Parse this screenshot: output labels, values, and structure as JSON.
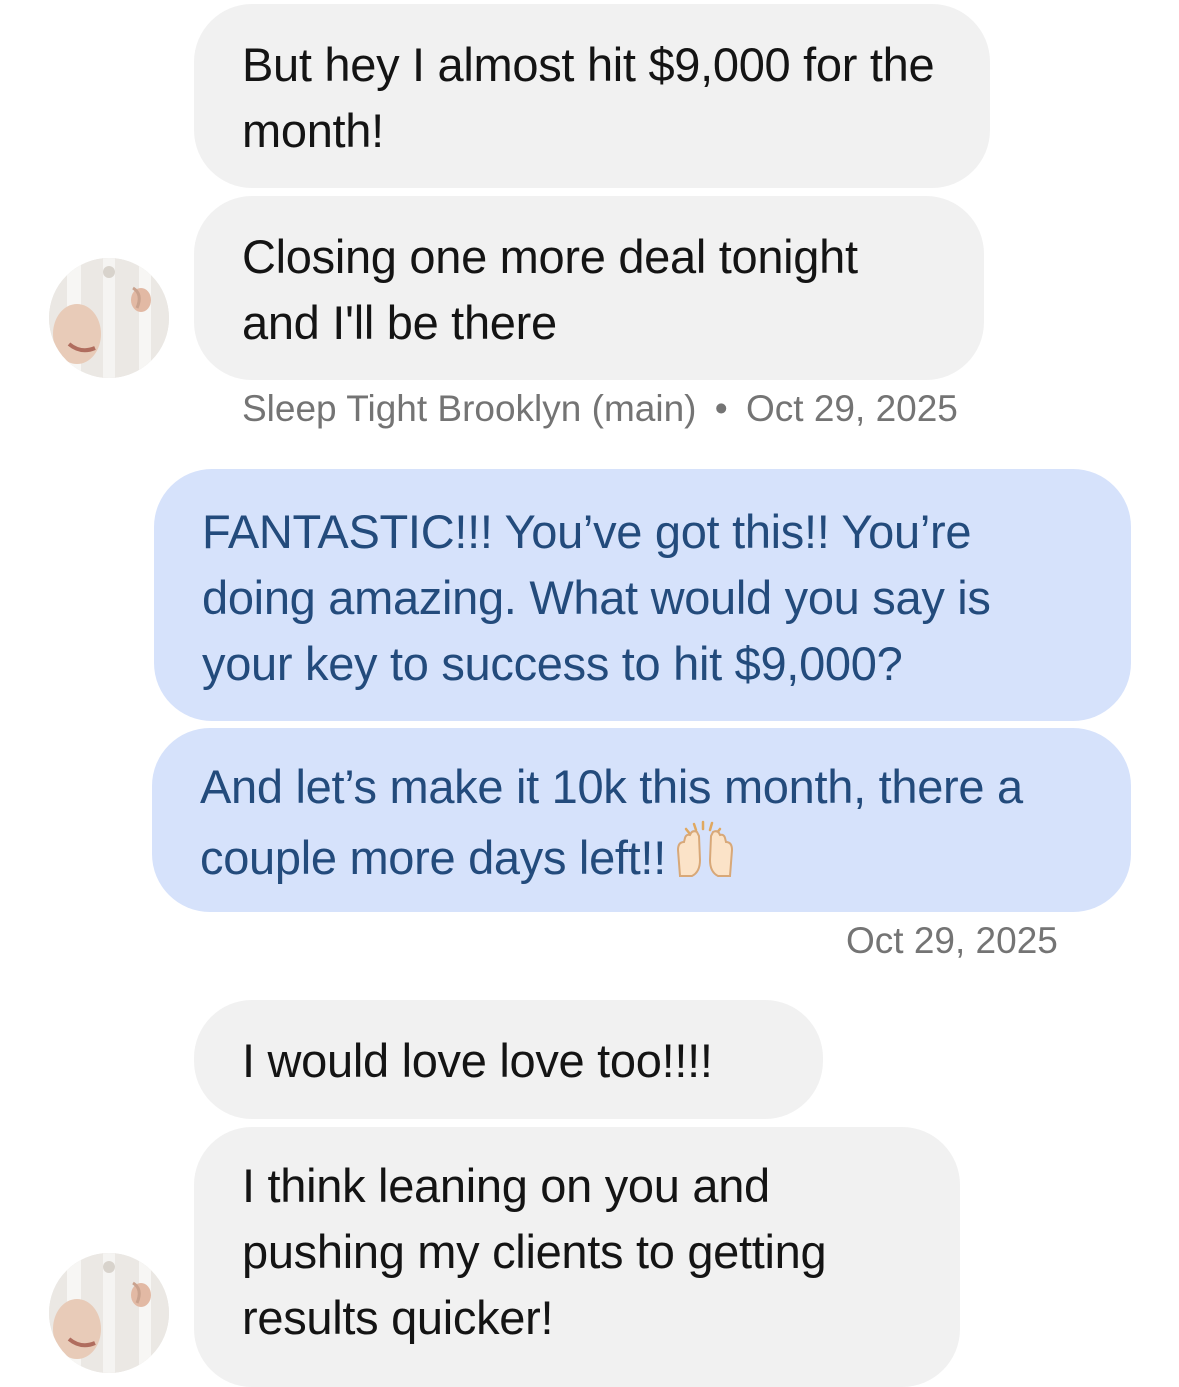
{
  "conversation": {
    "messages": [
      {
        "id": "m1",
        "direction": "incoming",
        "text": "But hey I almost hit $9,000 for the month!"
      },
      {
        "id": "m2",
        "direction": "incoming",
        "text": "Closing one more deal tonight and I'll be there"
      },
      {
        "id": "m3",
        "direction": "outgoing",
        "text": "FANTASTIC!!! You’ve got this!! You’re doing amazing. What would you say is your key to success to hit $9,000?"
      },
      {
        "id": "m4",
        "direction": "outgoing",
        "text": "And let’s make it 10k this month, there a couple more days left!!",
        "emoji": "raising-hands-emoji"
      },
      {
        "id": "m5",
        "direction": "incoming",
        "text": "I would love love too!!!!"
      },
      {
        "id": "m6",
        "direction": "incoming",
        "text": "I think leaning on you and pushing my clients to getting results quicker!"
      }
    ],
    "group1_meta": {
      "sender": "Sleep Tight Brooklyn (main)",
      "separator": "•",
      "date": "Oct 29, 2025"
    },
    "group2_meta": {
      "date": "Oct 29, 2025"
    }
  },
  "colors": {
    "incoming_bubble": "#f1f1f1",
    "outgoing_bubble": "#d6e2fb",
    "outgoing_text": "#234b7c",
    "meta_text": "#747474"
  },
  "icons": {
    "avatar": "sender-avatar-photo",
    "emoji": "raising-hands-emoji"
  }
}
